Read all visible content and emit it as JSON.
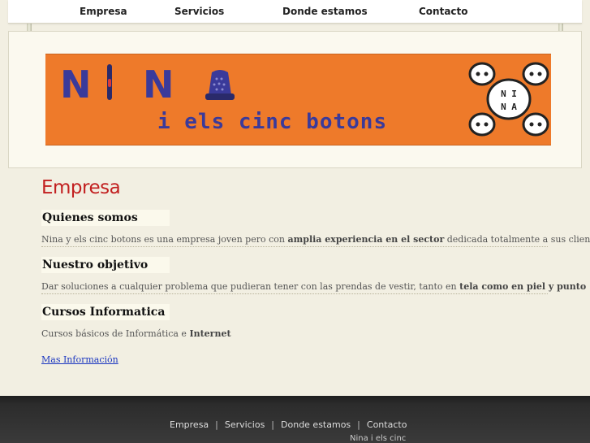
{
  "nav": {
    "items": [
      {
        "label": "Empresa"
      },
      {
        "label": "Servicios"
      },
      {
        "label": "Donde estamos"
      },
      {
        "label": "Contacto"
      }
    ]
  },
  "banner": {
    "logo_letters": [
      "N",
      "N"
    ],
    "subtitle": "i els cinc botons",
    "badge_top": "N I",
    "badge_bottom": "N A"
  },
  "main": {
    "title": "Empresa",
    "sections": [
      {
        "heading": "Quienes somos",
        "text_before": "Nina y els cinc botons es una empresa joven pero con ",
        "text_bold": "amplia experiencia en el sector",
        "text_after": " dedicada totalmente a sus clientes"
      },
      {
        "heading": "Nuestro objetivo",
        "text_before": "Dar soluciones a cualquier problema que pudieran tener con las prendas de vestir, tanto en ",
        "text_bold": "tela como en piel y punto",
        "text_after": ""
      },
      {
        "heading": "Cursos Informatica",
        "text_before": "Cursos básicos de Informática e ",
        "text_bold": "Internet",
        "text_after": ""
      }
    ],
    "more_link": "Mas Información"
  },
  "footer": {
    "nav": [
      "Empresa",
      "Servicios",
      "Donde estamos",
      "Contacto"
    ],
    "separator": "|",
    "copyright": "Nina i els cinc"
  },
  "colors": {
    "accent_title": "#c22020",
    "banner_bg": "#ee7a2a",
    "logo_blue": "#3a3a9a",
    "link": "#1a36c0"
  }
}
